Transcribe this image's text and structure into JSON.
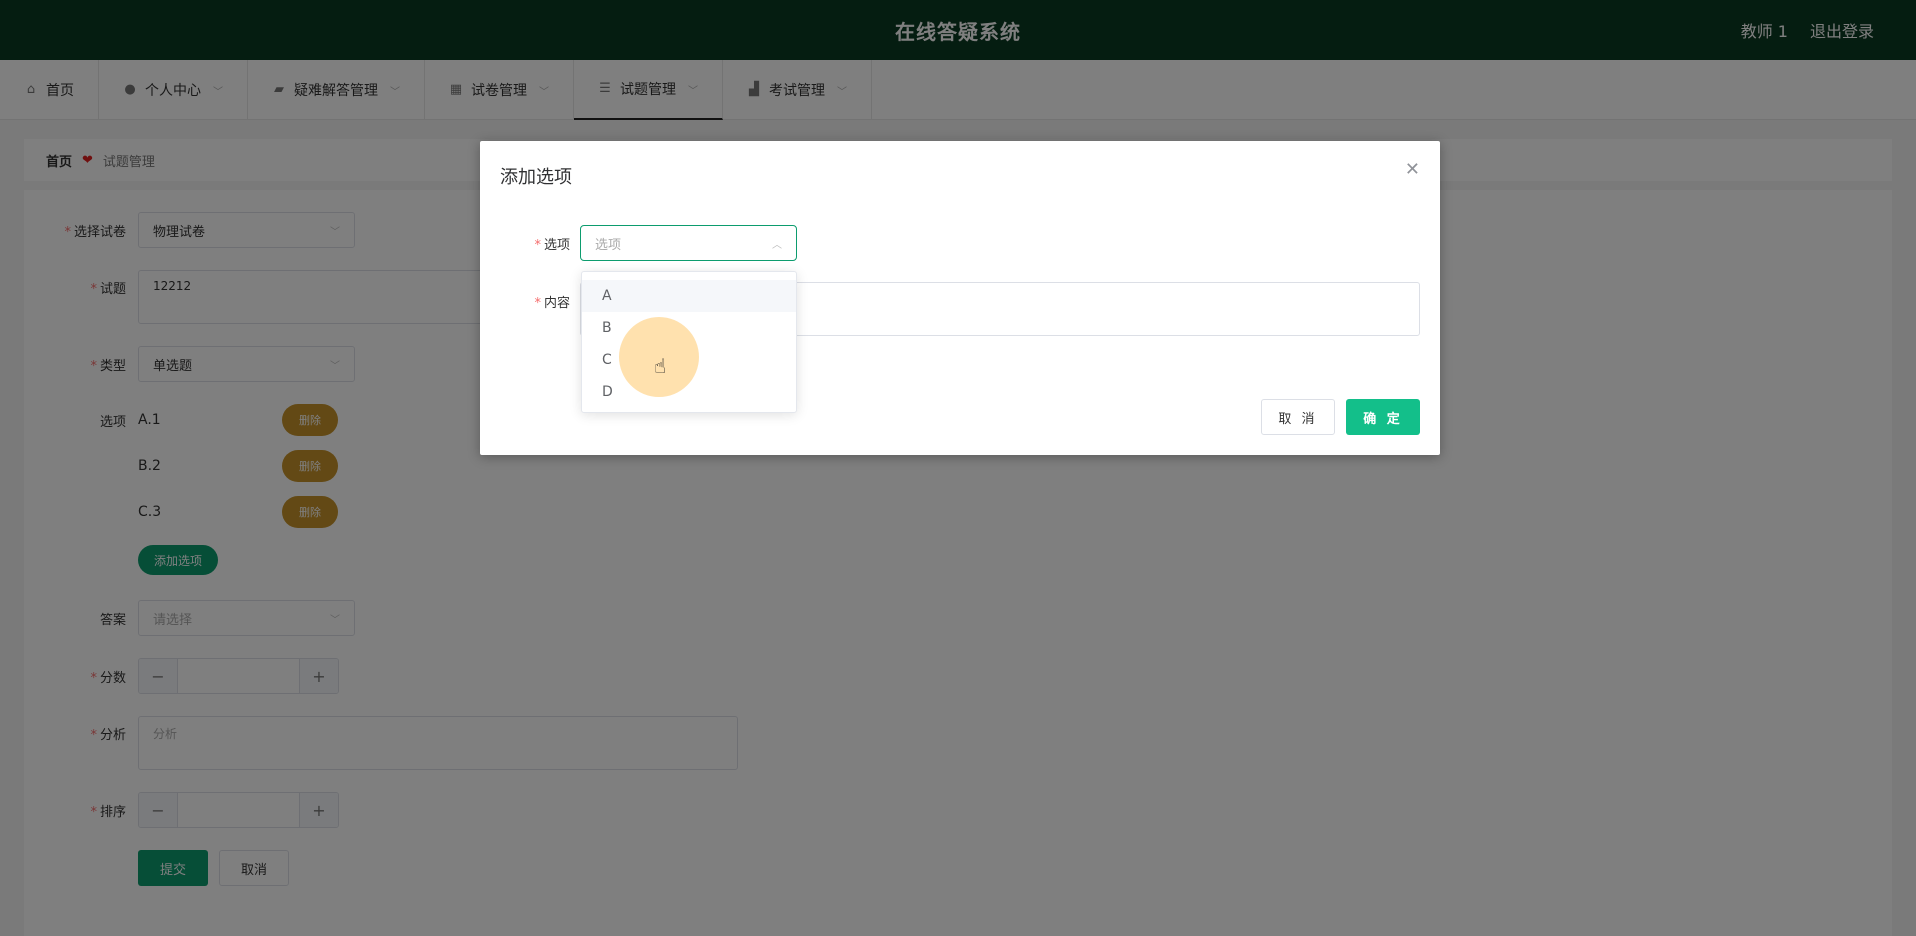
{
  "header": {
    "title": "在线答疑系统",
    "user": "教师 1",
    "logout": "退出登录"
  },
  "nav": {
    "items": [
      {
        "label": "首页",
        "icon": "home-icon"
      },
      {
        "label": "个人中心",
        "icon": "user-icon"
      },
      {
        "label": "疑难解答管理",
        "icon": "ticket-icon"
      },
      {
        "label": "试卷管理",
        "icon": "grid-icon"
      },
      {
        "label": "试题管理",
        "icon": "list-icon"
      },
      {
        "label": "考试管理",
        "icon": "briefcase-icon"
      }
    ],
    "active_index": 4
  },
  "breadcrumb": {
    "home": "首页",
    "current": "试题管理"
  },
  "form": {
    "paper_label": "选择试卷",
    "paper_value": "物理试卷",
    "question_label": "试题",
    "question_value": "12212",
    "type_label": "类型",
    "type_value": "单选题",
    "options_label": "选项",
    "options": [
      {
        "text": "A.1",
        "delete": "删除"
      },
      {
        "text": "B.2",
        "delete": "删除"
      },
      {
        "text": "C.3",
        "delete": "删除"
      }
    ],
    "add_option": "添加选项",
    "answer_label": "答案",
    "answer_placeholder": "请选择",
    "score_label": "分数",
    "analysis_label": "分析",
    "analysis_placeholder": "分析",
    "order_label": "排序",
    "submit": "提交",
    "cancel": "取消"
  },
  "dialog": {
    "title": "添加选项",
    "option_label": "选项",
    "option_placeholder": "选项",
    "content_label": "内容",
    "cancel": "取 消",
    "ok": "确 定"
  },
  "dropdown": {
    "options": [
      "A",
      "B",
      "C",
      "D"
    ],
    "hovered_index": 0
  },
  "colors": {
    "header_bg": "#0b3a22",
    "primary": "#0c9c6e",
    "dialog_ok": "#13bf8a",
    "delete": "#c7932a",
    "required": "#f56c6c"
  }
}
